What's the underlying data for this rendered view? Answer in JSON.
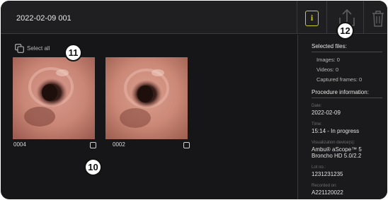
{
  "header": {
    "title": "2022-02-09 001",
    "info_label": "i"
  },
  "gallery": {
    "select_all_label": "Select all",
    "items": [
      {
        "id": "0004"
      },
      {
        "id": "0002"
      }
    ]
  },
  "callouts": [
    "10",
    "11",
    "12"
  ],
  "panel": {
    "selected_heading": "Selected files:",
    "images": "Images: 0",
    "videos": "Videos: 0",
    "frames": "Captured frames: 0",
    "procedure_heading": "Procedure information:",
    "date_label": "Date:",
    "date_value": "2022-02-09",
    "time_label": "Time:",
    "time_value": "15:14 - In progress",
    "device_label": "Visualization device(s):",
    "device_value_1": "Ambu® aScope™ 5",
    "device_value_2": "Broncho HD 5.0/2.2",
    "lot_label": "Lot no.:",
    "lot_value": "1231231235",
    "recorded_label": "Recorded on:",
    "recorded_value": "A221120022"
  },
  "colors": {
    "accent": "#c6cc2c",
    "background": "#161618"
  }
}
